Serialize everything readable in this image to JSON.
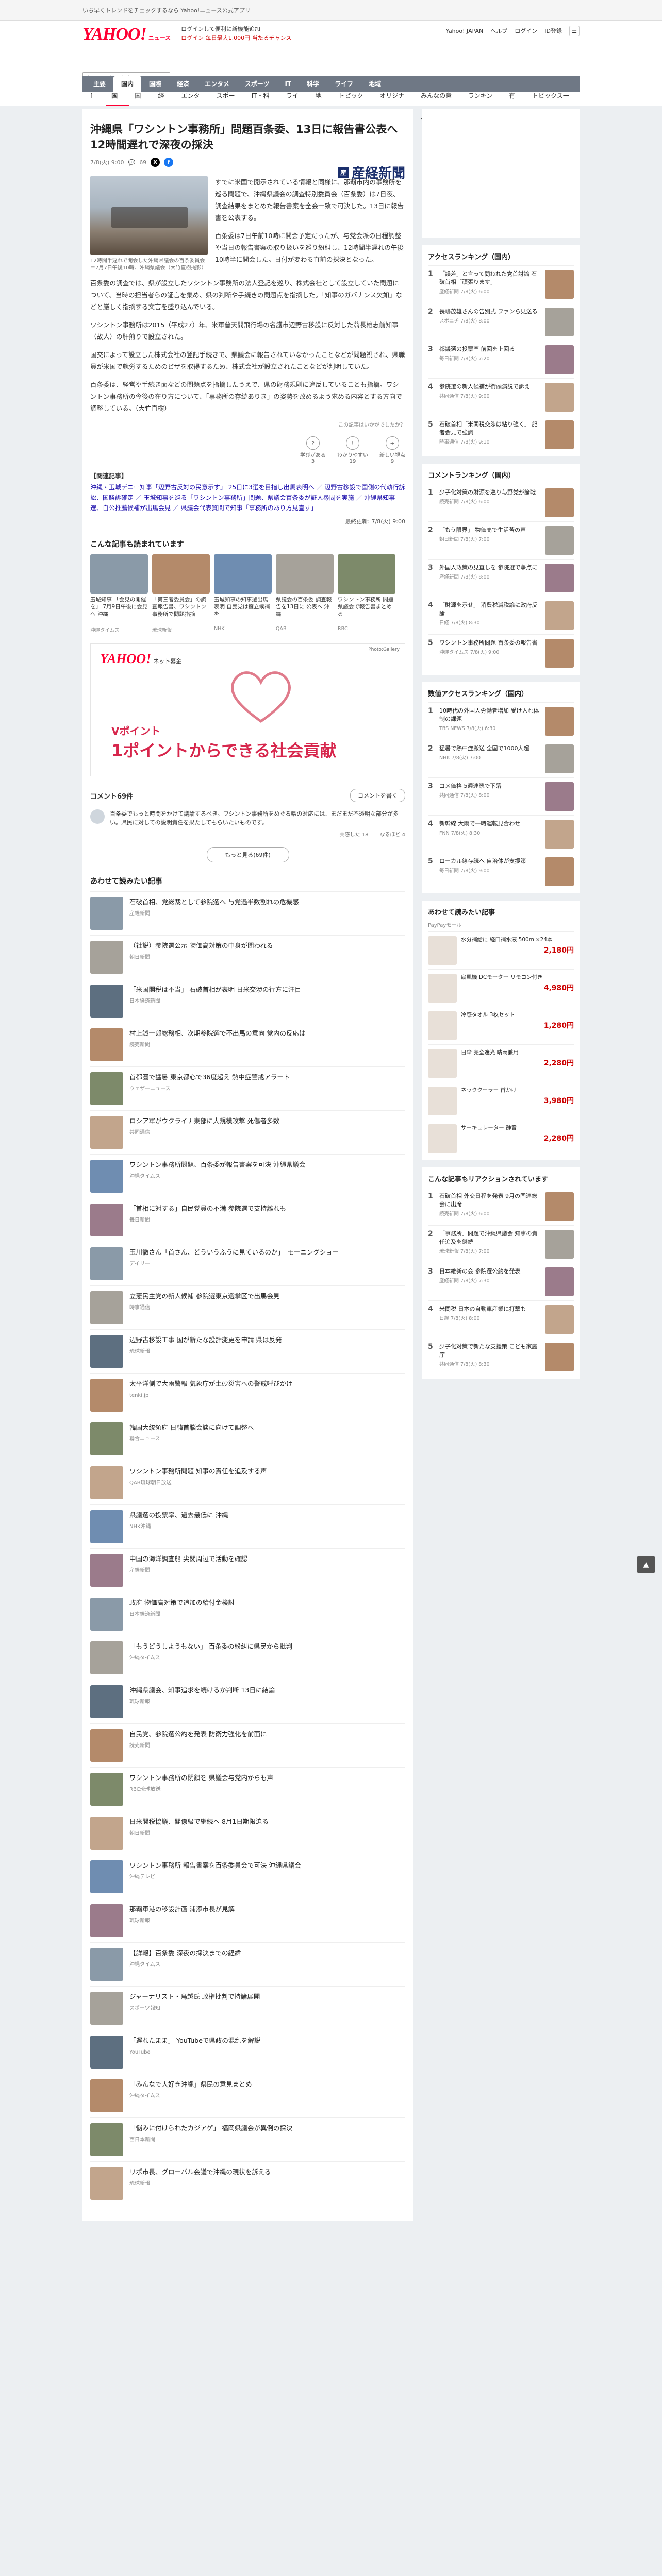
{
  "promo": {
    "text": "いち早くトレンドをチェックするなら Yahoo!ニュース公式アプリ"
  },
  "masthead": {
    "logo": "YAHOO!",
    "logo_sub": "ニュース",
    "notice_1": "ログインして便利に新機能追加",
    "notice_2": "ログイン 毎日最大1,000円 当たるチャンス",
    "links": [
      "Yahoo! JAPAN",
      "ヘルプ",
      "ログイン",
      "ID登録"
    ],
    "search_placeholder": "キーワードを入力"
  },
  "catnav": [
    "主要",
    "国内",
    "国際",
    "経済",
    "エンタメ",
    "スポーツ",
    "IT",
    "科学",
    "ライフ",
    "地域"
  ],
  "subnav": [
    "主要",
    "国内",
    "国際",
    "経済",
    "エンタメ",
    "スポーツ",
    "IT・科学",
    "ライフ",
    "地域",
    "トピックス",
    "オリジナル",
    "みんなの意見",
    "ランキング",
    "有料"
  ],
  "subnav_right": "トピックス一覧",
  "article": {
    "headline": "沖縄県「ワシントン事務所」問題百条委、13日に報告書公表へ　12時間遅れで深夜の採決",
    "date": "7/8(火) 9:00",
    "comments_count": "69",
    "publisher": "産経新聞",
    "caption": "12時間半遅れで開会した沖縄県議会の百条委員会＝7月7日午後10時、沖縄県議会（大竹直樹撮影）",
    "paragraphs": [
      "すでに米国で開示されている情報と同様に、那覇市内の事務所を巡る問題で、沖縄県議会の調査特別委員会（百条委）は7日夜、調査結果をまとめた報告書案を全会一致で可決した。13日に報告書を公表する。",
      "百条委は7日午前10時に開会予定だったが、与党会派の日程調整や当日の報告書案の取り扱いを巡り紛糾し、12時間半遅れの午後10時半に開会した。日付が変わる直前の採決となった。",
      "百条委の調査では、県が設立したワシントン事務所の法人登記を巡り、株式会社として設立していた問題について、当時の担当者らの証言を集め、県の判断や手続きの問題点を指摘した。「知事のガバナンス欠如」などと厳しく指摘する文言を盛り込んでいる。",
      "ワシントン事務所は2015（平成27）年、米軍普天間飛行場の名護市辺野古移設に反対した翁長雄志前知事（故人）の肝煎りで設立された。",
      "国交によって設立した株式会社の登記手続きで、県議会に報告されていなかったことなどが問題視され、県職員が米国で就労するためのビザを取得するため、株式会社が設立されたことなどが判明していた。",
      "百条委は、経営や手続き面などの問題点を指摘したうえで、県の財務規則に違反していることも指摘。ワシントン事務所の今後の在り方について、「事務所の存続ありき」の姿勢を改めるよう求める内容とする方向で調整している。（大竹直樹）"
    ],
    "reactions": [
      {
        "icon": "?",
        "label": "学びがある",
        "count": "3"
      },
      {
        "icon": "!",
        "label": "わかりやすい",
        "count": "19"
      },
      {
        "icon": "+",
        "label": "新しい視点",
        "count": "9"
      }
    ],
    "reaction_note": "この記事はいかがでしたか？",
    "related_title": "【関連記事】",
    "related_body": "沖縄・玉城デニー知事「辺野古反対の民意示す」 25日に3選を目指し出馬表明へ ／ 辺野古移設で国側の代執行訴訟、国勝訴確定 ／ 玉城知事を巡る「ワシントン事務所」問題、県議会百条委が証人尋問を実施 ／ 沖縄県知事選、自公推薦候補が出馬会見 ／ 県議会代表質問で知事「事務所のあり方見直す」",
    "byline": "最終更新: 7/8(火) 9:00"
  },
  "also_read": {
    "title": "こんな記事も読まれています",
    "items": [
      {
        "title": "玉城知事 「会見の開催を」 7月9日午後に会見へ 沖縄",
        "src": "沖縄タイムス"
      },
      {
        "title": "「第三者委員会」の調査報告書、ワシントン事務所で問題指摘",
        "src": "琉球新報"
      },
      {
        "title": "玉城知事の知事選出馬表明 自民党は擁立候補を",
        "src": "NHK"
      },
      {
        "title": "県議会の百条委 調査報告を13日に 公表へ 沖縄",
        "src": "QAB"
      },
      {
        "title": "ワシントン事務所 問題 県議会で報告書まとめる",
        "src": "RBC"
      }
    ]
  },
  "ad": {
    "brand": "YAHOO!",
    "brand_sub": "ネット募金",
    "credit": "Photo:Gallery",
    "copy_small": "Vポイント",
    "copy": "1ポイントからできる社会貢献"
  },
  "comments": {
    "title": "コメント69件",
    "button": "コメントを書く",
    "sample": "百条委でもっと時間をかけて議論するべき。ワシントン事務所をめぐる県の対応には、まだまだ不透明な部分が多い。県民に対しての説明責任を果たしてもらいたいものです。",
    "like": "共感した",
    "like_count": "18",
    "hmm": "なるほど",
    "hmm_count": "4",
    "more": "もっと見る(69件)"
  },
  "feed": {
    "title": "あわせて読みたい記事",
    "items": [
      {
        "title": "石破首相、党総裁として参院選へ 与党過半数割れの危機感",
        "src": "産経新聞"
      },
      {
        "title": "（社説）参院選公示 物価高対策の中身が問われる",
        "src": "朝日新聞"
      },
      {
        "title": "「米国関税は不当」 石破首相が表明 日米交渉の行方に注目",
        "src": "日本経済新聞"
      },
      {
        "title": "村上誠一郎総務相、次期参院選で不出馬の意向 党内の反応は",
        "src": "読売新聞"
      },
      {
        "title": "首都圏で猛暑 東京都心で36度超え 熱中症警戒アラート",
        "src": "ウェザーニュース"
      },
      {
        "title": "ロシア軍がウクライナ東部に大規模攻撃 死傷者多数",
        "src": "共同通信"
      },
      {
        "title": "ワシントン事務所問題、百条委が報告書案を可決 沖縄県議会",
        "src": "沖縄タイムス"
      },
      {
        "title": "「首相に対する」自民党員の不満 参院選で支持離れも",
        "src": "毎日新聞"
      },
      {
        "title": "玉川徹さん「首さん、どういうふうに見ているのか」　モーニングショー",
        "src": "デイリー"
      },
      {
        "title": "立憲民主党の新人候補 参院選東京選挙区で出馬会見",
        "src": "時事通信"
      },
      {
        "title": "辺野古移設工事 国が新たな設計変更を申請 県は反発",
        "src": "琉球新報"
      },
      {
        "title": "太平洋側で大雨警報 気象庁が土砂災害への警戒呼びかけ",
        "src": "tenki.jp"
      },
      {
        "title": "韓国大統領府 日韓首脳会談に向けて調整へ",
        "src": "聯合ニュース"
      },
      {
        "title": "ワシントン事務所問題 知事の責任を追及する声",
        "src": "QAB琉球朝日放送"
      },
      {
        "title": "県議選の投票率、過去最低に 沖縄",
        "src": "NHK沖縄"
      },
      {
        "title": "中国の海洋調査船 尖閣周辺で活動を確認",
        "src": "産経新聞"
      },
      {
        "title": "政府 物価高対策で追加の給付金検討",
        "src": "日本経済新聞"
      },
      {
        "title": "「もうどうしようもない」 百条委の紛糾に県民から批判",
        "src": "沖縄タイムス"
      },
      {
        "title": "沖縄県議会、知事追求を続けるか判断 13日に結論",
        "src": "琉球新報"
      },
      {
        "title": "自民党、参院選公約を発表 防衛力強化を前面に",
        "src": "読売新聞"
      },
      {
        "title": "ワシントン事務所の閉鎖を 県議会与党内からも声",
        "src": "RBC琉球放送"
      },
      {
        "title": "日米関税協議、閣僚級で継続へ 8月1日期限迫る",
        "src": "朝日新聞"
      },
      {
        "title": "ワシントン事務所 報告書案を百条委員会で可決 沖縄県議会",
        "src": "沖縄テレビ"
      },
      {
        "title": "那覇軍港の移設計画 浦添市長が見解",
        "src": "琉球新報"
      },
      {
        "title": "【詳報】百条委 深夜の採決までの経緯",
        "src": "沖縄タイムス"
      },
      {
        "title": "ジャーナリスト・鳥越氏 政権批判で持論展開",
        "src": "スポーツ報知"
      },
      {
        "title": "「遅れたまま」 YouTubeで県政の混乱を解説",
        "src": "YouTube"
      },
      {
        "title": "「みんなで大好き沖縄」県民の意見まとめ",
        "src": "沖縄タイムス"
      },
      {
        "title": "「悩みに付けられたカジアゲ」 福岡県議会が異例の採決",
        "src": "西日本新聞"
      },
      {
        "title": "リポ市長、グローバル会議で沖縄の現状を訴える",
        "src": "琉球新報"
      }
    ]
  },
  "side": {
    "access_title": "アクセスランキング（国内）",
    "access": [
      {
        "t": "「誤差」と言って問われた党首討論 石破首相「頑張ります」",
        "s": "産経新聞 7/8(火) 6:00"
      },
      {
        "t": "長嶋茂雄さんの告別式 ファンら見送る",
        "s": "スポニチ 7/8(火) 8:00"
      },
      {
        "t": "都議選の投票率 前回を上回る",
        "s": "毎日新聞 7/8(火) 7:20"
      },
      {
        "title_x": "",
        "t": "参院選の新人候補が街頭演説で訴え",
        "s": "共同通信 7/8(火) 9:00"
      },
      {
        "t": "石破首相「米関税交渉は粘り強く」 記者会見で強調",
        "s": "時事通信 7/8(火) 9:10"
      }
    ],
    "comment_rank_title": "コメントランキング（国内）",
    "comment_rank": [
      {
        "t": "少子化対策の財源を巡り与野党が論戦",
        "s": "読売新聞 7/8(火) 6:00"
      },
      {
        "t": "「もう限界」 物価高で生活苦の声",
        "s": "朝日新聞 7/8(火) 7:00"
      },
      {
        "t": "外国人政策の見直しを 参院選で争点に",
        "s": "産経新聞 7/8(火) 8:00"
      },
      {
        "t": "「財源を示せ」 消費税減税論に政府反論",
        "s": "日経 7/8(火) 8:30"
      },
      {
        "t": "ワシントン事務所問題 百条委の報告書",
        "s": "沖縄タイムス 7/8(火) 9:00"
      }
    ],
    "topic_title": "数値アクセスランキング（国内）",
    "topic": [
      {
        "t": "10時代の外国人労働者増加 受け入れ体制の課題",
        "s": "TBS NEWS 7/8(火) 6:30"
      },
      {
        "t": "猛暑で熱中症搬送 全国で1000人超",
        "s": "NHK 7/8(火) 7:00"
      },
      {
        "t": "コメ価格 5週連続で下落",
        "s": "共同通信 7/8(火) 8:00"
      },
      {
        "t": "新幹線 大雨で一時運転見合わせ",
        "s": "FNN 7/8(火) 8:30"
      },
      {
        "t": "ローカル線存続へ 自治体が支援策",
        "s": "毎日新聞 7/8(火) 9:00"
      }
    ],
    "shop_title": "あわせて読みたい記事",
    "shop_sub": "PayPayモール",
    "shop": [
      {
        "t": "水分補給に 経口補水液 500ml×24本",
        "p": "2,180円"
      },
      {
        "t": "扇風機 DCモーター リモコン付き",
        "p": "4,980円"
      },
      {
        "t": "冷感タオル 3枚セット",
        "p": "1,280円"
      },
      {
        "t": "日傘 完全遮光 晴雨兼用",
        "p": "2,280円"
      },
      {
        "t": "ネッククーラー 首かけ",
        "p": "3,980円"
      },
      {
        "t": "サーキュレーター 静音",
        "p": "2,280円"
      }
    ],
    "reaction_title": "こんな記事もリアクションされています",
    "reaction": [
      {
        "t": "石破首相 外交日程を発表 9月の国連総会に出席",
        "s": "読売新聞 7/8(火) 6:00"
      },
      {
        "t": "「事務所」問題で沖縄県議会 知事の責任追及を継続",
        "s": "琉球新報 7/8(火) 7:00"
      },
      {
        "t": "日本維新の会 参院選公約を発表",
        "s": "産経新聞 7/8(火) 7:30"
      },
      {
        "t": "米関税 日本の自動車産業に打撃も",
        "s": "日経 7/8(火) 8:00"
      },
      {
        "t": "少子化対策で新たな支援策 こども家庭庁",
        "s": "共同通信 7/8(火) 8:30"
      }
    ]
  },
  "colors": {
    "accent": "#ff0033",
    "nav": "#6f7885",
    "link": "#1a0dab"
  }
}
